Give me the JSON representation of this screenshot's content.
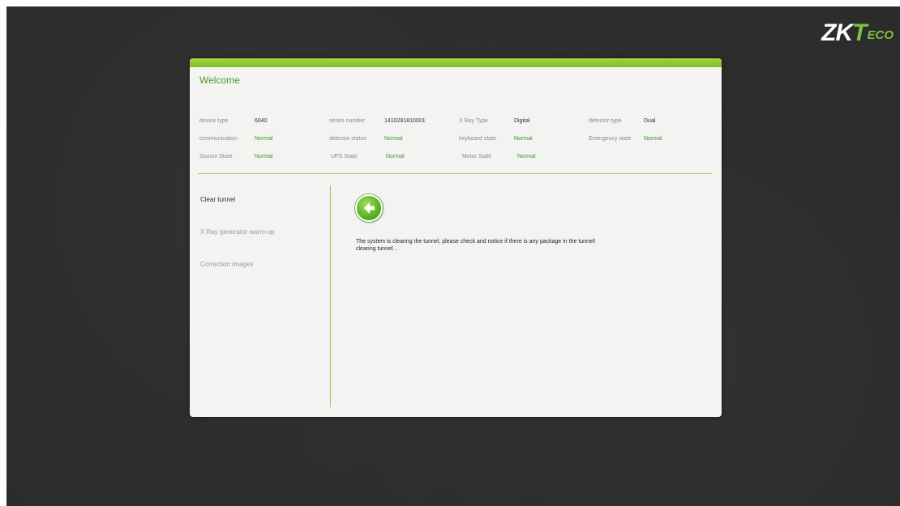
{
  "logo": {
    "zk": "ZK",
    "t": "T",
    "eco": "ECO"
  },
  "panel": {
    "title": "Welcome",
    "status": [
      [
        {
          "label": "device type",
          "value": "6040",
          "ok": false
        },
        {
          "label": "series number",
          "value": "1410281810001",
          "ok": false
        },
        {
          "label": "X Ray Type",
          "value": "Digital",
          "ok": false
        },
        {
          "label": "detector type",
          "value": "Dual",
          "ok": false
        }
      ],
      [
        {
          "label": "communication",
          "value": "Normal",
          "ok": true
        },
        {
          "label": "detector status",
          "value": "Normal",
          "ok": true
        },
        {
          "label": "keyboard state",
          "value": "Normal",
          "ok": true
        },
        {
          "label": "Emergency state",
          "value": "Normal",
          "ok": true
        }
      ],
      [
        {
          "label": "Source State",
          "value": "Normal",
          "ok": true
        },
        {
          "label": "UPS State",
          "value": "Normal",
          "ok": true
        },
        {
          "label": "Motor State",
          "value": "Normal",
          "ok": true
        }
      ]
    ],
    "menu": [
      {
        "label": "Clear tunnel",
        "active": true
      },
      {
        "label": "X Ray generator warm-up",
        "active": false
      },
      {
        "label": "Correction Images",
        "active": false
      }
    ],
    "back_icon": "arrow-left-icon",
    "message_line1": "The system is clearing the tunnel, please check and notice if there is any package in the tunnel!",
    "message_line2": "clearing tunnel..."
  },
  "colors": {
    "background": "#2b2b2b",
    "accent_green": "#7cbe2e",
    "ok_text": "#3c9a2a",
    "panel": "#f3f3f1"
  }
}
